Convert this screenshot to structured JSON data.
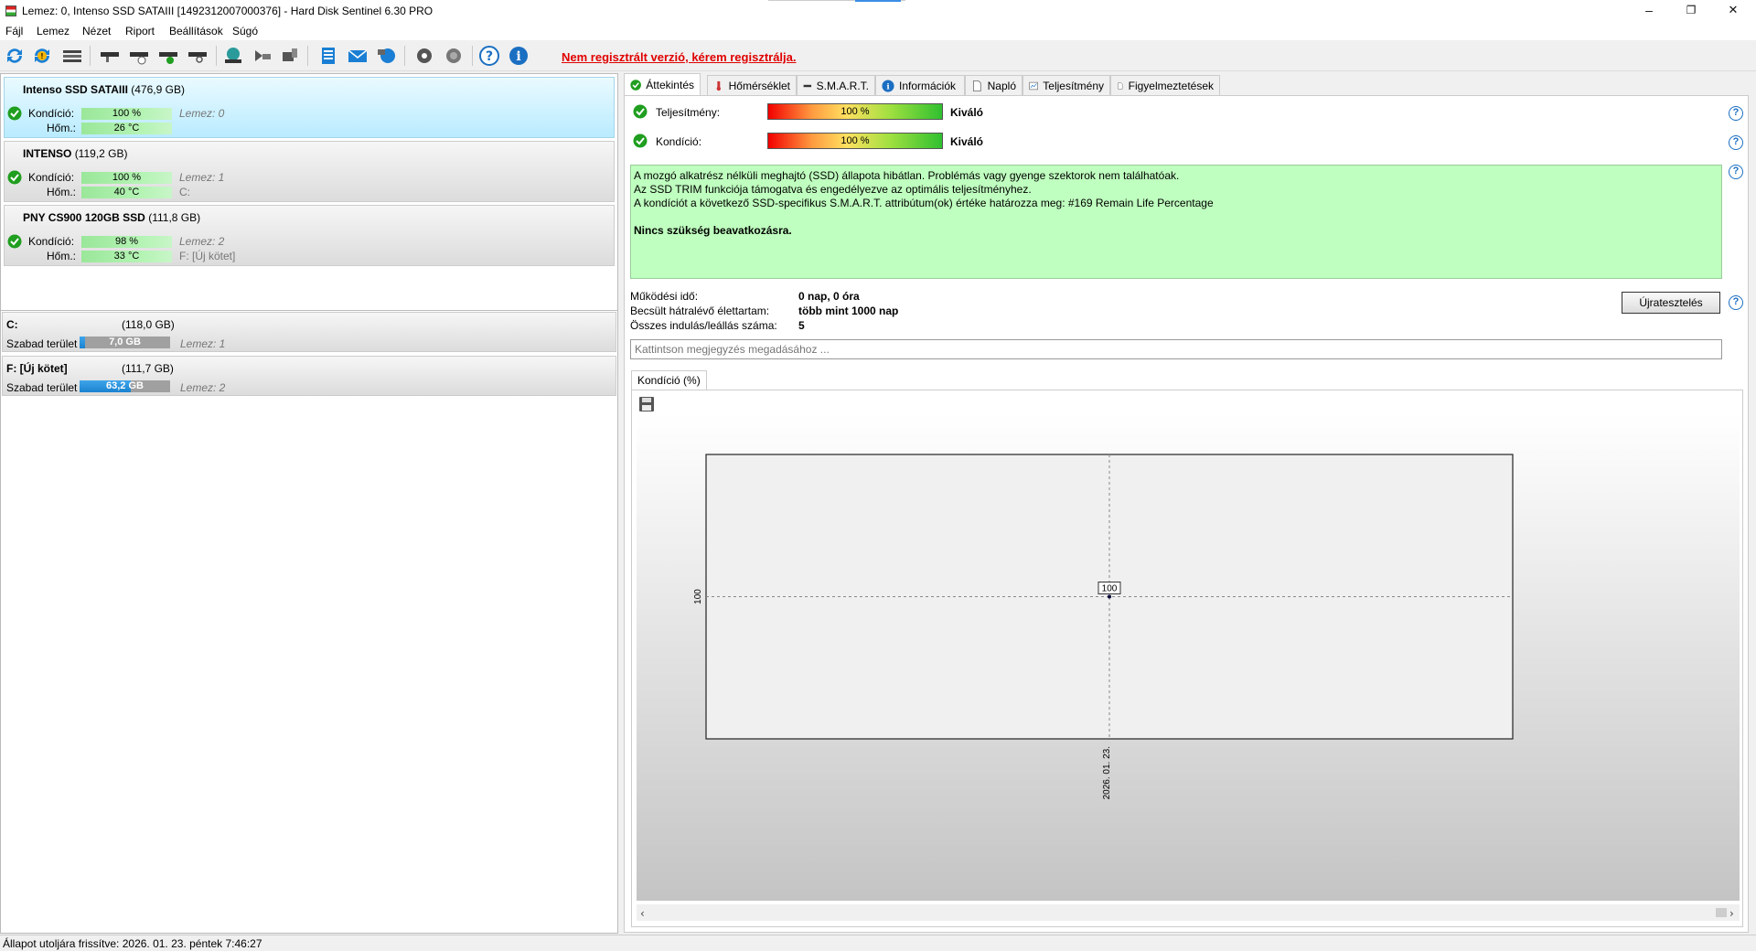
{
  "window": {
    "title": "Lemez: 0, Intenso SSD SATAIII [1492312007000376]  -  Hard Disk Sentinel 6.30 PRO",
    "minimize": "–",
    "maximize": "❐",
    "close": "✕"
  },
  "menu": [
    "Fájl",
    "Lemez",
    "Nézet",
    "Riport",
    "Beállítások",
    "Súgó"
  ],
  "toolbar": {
    "registration_text": "Nem regisztrált verzió, kérem regisztrálja."
  },
  "disks": [
    {
      "name": "Intenso SSD SATAIII",
      "size": "(476,9 GB)",
      "condition_label": "Kondíció:",
      "condition": "100 %",
      "condition_pct": 100,
      "disk_label": "Lemez: 0",
      "temp_label": "Hőm.:",
      "temp": "26 °C",
      "drive": ""
    },
    {
      "name": "INTENSO",
      "size": "(119,2 GB)",
      "condition_label": "Kondíció:",
      "condition": "100 %",
      "condition_pct": 100,
      "disk_label": "Lemez: 1",
      "temp_label": "Hőm.:",
      "temp": "40 °C",
      "drive": "C:"
    },
    {
      "name": "PNY CS900 120GB SSD",
      "size": "(111,8 GB)",
      "condition_label": "Kondíció:",
      "condition": "98 %",
      "condition_pct": 98,
      "disk_label": "Lemez: 2",
      "temp_label": "Hőm.:",
      "temp": "33 °C",
      "drive": "F: [Új kötet]"
    }
  ],
  "volumes": [
    {
      "name": "C:",
      "size": "(118,0 GB)",
      "free_label": "Szabad terület",
      "free": "7,0 GB",
      "free_pct": 6,
      "disk_label": "Lemez: 1"
    },
    {
      "name": "F: [Új kötet]",
      "size": "(111,7 GB)",
      "free_label": "Szabad terület",
      "free": "63,2 GB",
      "free_pct": 57,
      "disk_label": "Lemez: 2"
    }
  ],
  "tabs": [
    "Áttekintés",
    "Hőmérséklet",
    "S.M.A.R.T.",
    "Információk",
    "Napló",
    "Teljesítmény",
    "Figyelmeztetések"
  ],
  "overview": {
    "performance_label": "Teljesítmény:",
    "performance_value": "100 %",
    "performance_rating": "Kiváló",
    "condition_label": "Kondíció:",
    "condition_value": "100 %",
    "condition_rating": "Kiváló",
    "info_lines": [
      "A mozgó alkatrész nélküli meghajtó (SSD) állapota hibátlan. Problémás vagy gyenge szektorok nem találhatóak.",
      "Az SSD TRIM funkciója támogatva és engedélyezve az optimális teljesítményhez.",
      "A kondíciót a következő SSD-specifikus S.M.A.R.T. attribútum(ok) értéke határozza meg:  #169 Remain Life Percentage"
    ],
    "info_bold": "Nincs szükség beavatkozásra.",
    "uptime_label": "Működési idő:",
    "uptime_value": "0 nap, 0 óra",
    "life_label": "Becsült hátralévő élettartam:",
    "life_value": "több mint 1000 nap",
    "starts_label": "Összes indulás/leállás száma:",
    "starts_value": "5",
    "retest_button": "Újratesztelés",
    "note_placeholder": "Kattintson megjegyzés megadásához ...",
    "chart_tab": "Kondíció  (%)"
  },
  "status": {
    "text": "Állapot utoljára frissítve: 2026. 01. 23. péntek 7:46:27"
  },
  "chart_data": {
    "type": "line",
    "x": [
      "2026. 01. 23."
    ],
    "series": [
      {
        "values": [
          100
        ]
      }
    ],
    "data_labels": [
      "100"
    ],
    "y_tick_labels": [
      "100"
    ],
    "x_tick_labels": [
      "2026. 01. 23."
    ],
    "grid": true
  },
  "colors": {
    "registration": "#e00000",
    "info_background": "#bfffbf",
    "selected_disk": "#b9ebff",
    "ok_green": "#1f9e1f"
  }
}
